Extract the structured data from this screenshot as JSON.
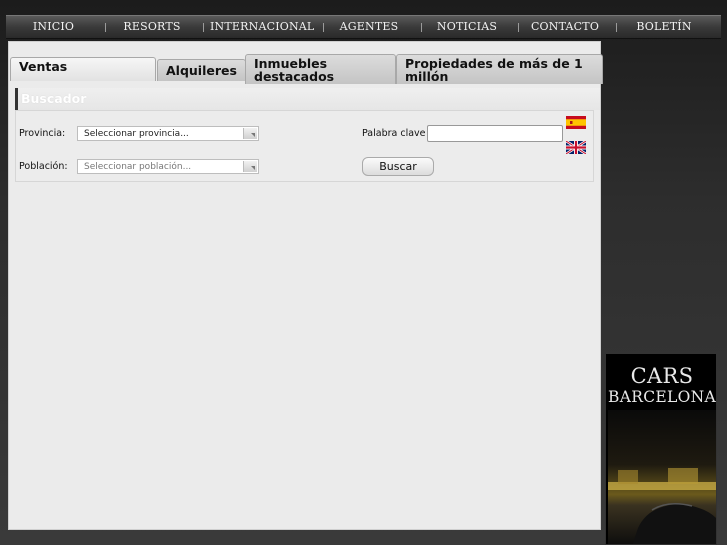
{
  "nav": {
    "items": [
      {
        "label": "INICIO"
      },
      {
        "label": "RESORTS"
      },
      {
        "label": "INTERNACIONAL"
      },
      {
        "label": "AGENTES"
      },
      {
        "label": "NOTICIAS"
      },
      {
        "label": "CONTACTO"
      },
      {
        "label": "BOLETÍN"
      }
    ]
  },
  "tabs": {
    "ventas": "Ventas",
    "alquileres": "Alquileres",
    "destacados": "Inmuebles destacados",
    "millon": "Propiedades de más de 1 millón"
  },
  "search": {
    "title": "Buscador",
    "provincia_label": "Provincia:",
    "provincia_value": "Seleccionar provincia...",
    "poblacion_label": "Población:",
    "poblacion_value": "Seleccionar población...",
    "keyword_label": "Palabra clave",
    "keyword_value": "",
    "button": "Buscar"
  },
  "ad": {
    "line1": "CARS",
    "line2": "BARCELONA"
  },
  "colors": {
    "panel": "#ebebeb",
    "background": "#2a2a2a",
    "nav_text": "#f2f2f2"
  }
}
